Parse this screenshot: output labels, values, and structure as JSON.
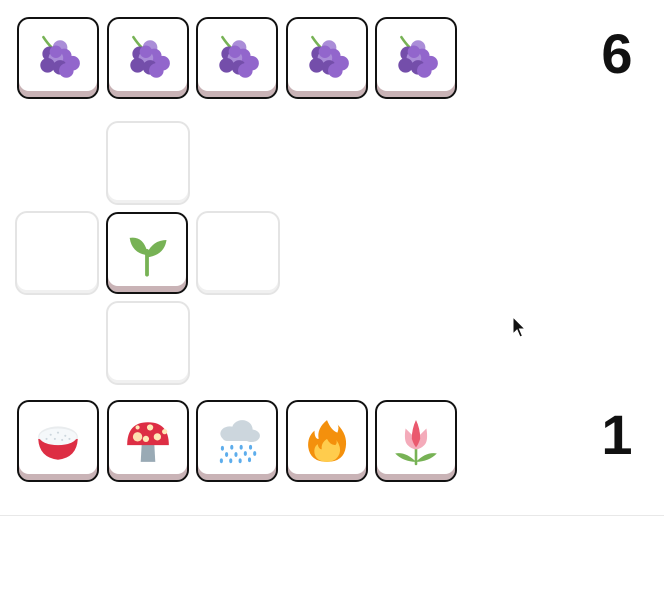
{
  "top_row": {
    "tiles": [
      {
        "icon": "grapes-icon"
      },
      {
        "icon": "grapes-icon"
      },
      {
        "icon": "grapes-icon"
      },
      {
        "icon": "grapes-icon"
      },
      {
        "icon": "grapes-icon"
      }
    ],
    "count": "6"
  },
  "board": {
    "center_tile": {
      "icon": "seedling-icon"
    },
    "empty_slots": [
      "up",
      "left",
      "right",
      "down"
    ]
  },
  "bottom_row": {
    "tiles": [
      {
        "icon": "rice-bowl-icon"
      },
      {
        "icon": "mushroom-icon"
      },
      {
        "icon": "rain-cloud-icon"
      },
      {
        "icon": "fire-icon"
      },
      {
        "icon": "tulip-icon"
      }
    ],
    "count": "1"
  },
  "colors": {
    "grape": "#8f5cc9",
    "seedling": "#77b255",
    "rice_bowl": "#dd2e44",
    "mushroom": "#dd2e44",
    "rain": "#5dadec",
    "fire": "#f4900c",
    "tulip": "#ea596e"
  }
}
